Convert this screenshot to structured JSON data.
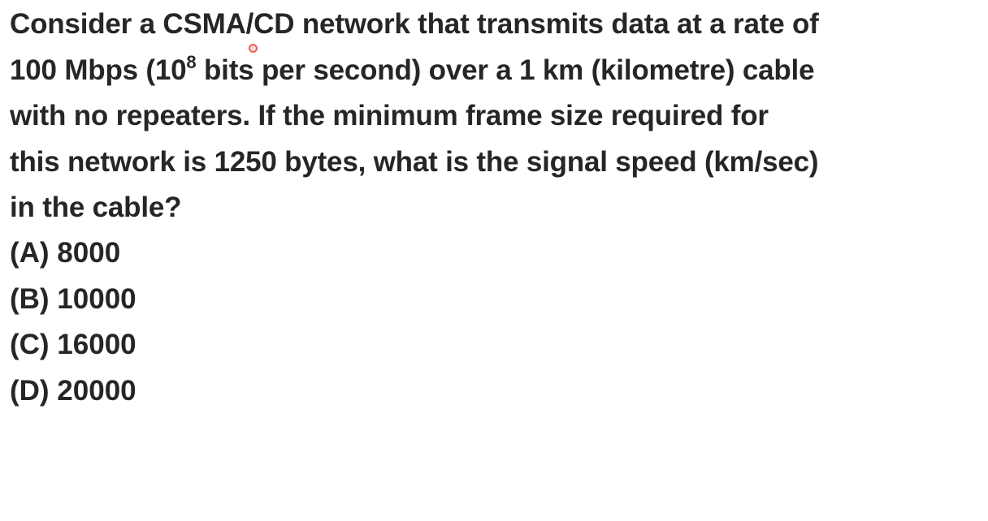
{
  "question": {
    "line1": "Consider a CSMA/CD network that transmits data at a rate of",
    "line2_pre": "100 Mbps (10",
    "line2_sup": "8",
    "line2_post": " bits per second) over a 1 km (kilometre) cable",
    "line3": "with no repeaters. If the minimum frame size required for",
    "line4": "this network is 1250 bytes, what is the signal speed (km/sec)",
    "line5": "in the cable?"
  },
  "options": [
    "(A) 8000",
    "(B) 10000",
    "(C) 16000",
    "(D) 20000"
  ],
  "colors": {
    "text": "#262626",
    "background": "#ffffff",
    "cursor": "#e8605a"
  }
}
